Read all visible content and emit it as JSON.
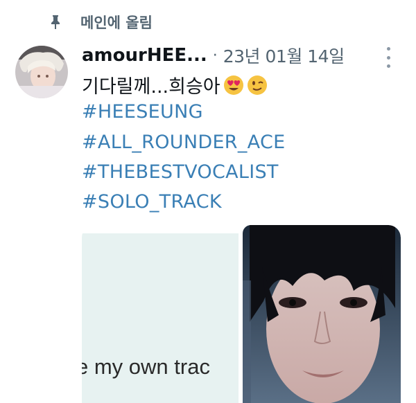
{
  "pinned": {
    "label": "메인에 올림",
    "icon": "pin-icon"
  },
  "tweet": {
    "username": "amourHEE...",
    "separator": "·",
    "date": "23년 01월 14일",
    "text": "기다릴께...희승아",
    "emojis": [
      "heart-eyes-emoji",
      "winking-face-emoji"
    ],
    "hashtags": [
      "#HEESEUNG",
      "#ALL_ROUNDER_ACE",
      "#THEBESTVOCALIST",
      "#SOLO_TRACK"
    ]
  },
  "media": {
    "left_caption": "e my own trac"
  },
  "colors": {
    "hashtag": "#3a7fb5",
    "muted": "#536471",
    "text": "#0f1419"
  }
}
